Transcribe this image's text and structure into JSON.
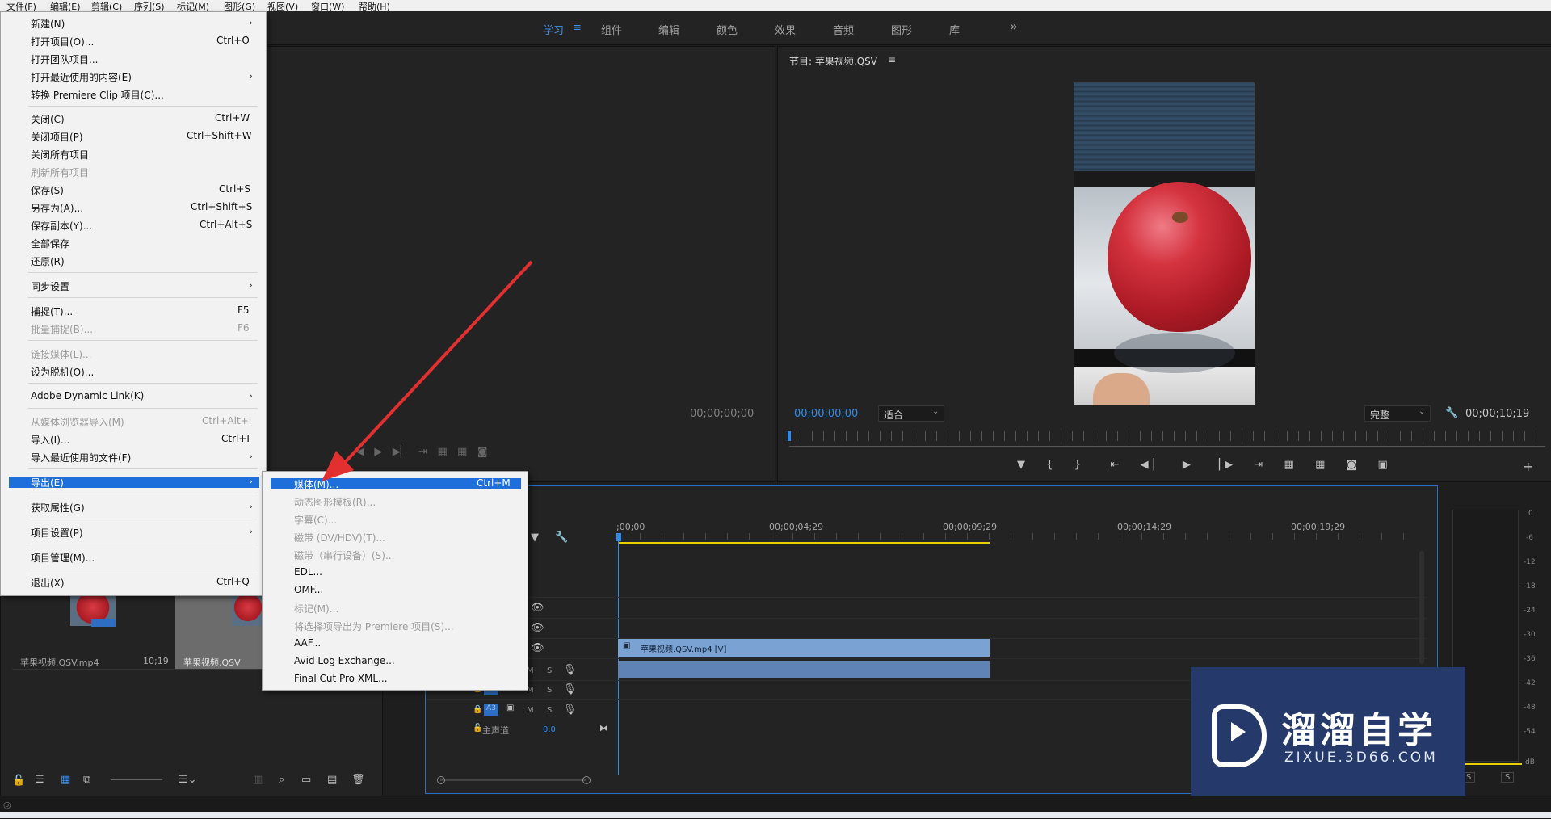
{
  "menubar": [
    "文件(F)",
    "编辑(E)",
    "剪辑(C)",
    "序列(S)",
    "标记(M)",
    "图形(G)",
    "视图(V)",
    "窗口(W)",
    "帮助(H)"
  ],
  "workspaces": [
    "学习",
    "组件",
    "编辑",
    "颜色",
    "效果",
    "音频",
    "图形",
    "库"
  ],
  "workspace_menu_icon": "≡",
  "more_icon": "»",
  "source_monitor": {
    "timecode": "00;00;00;00"
  },
  "program_monitor": {
    "title": "节目: 苹果视频.QSV",
    "title_menu": "≡",
    "timecode_left": "00;00;00;00",
    "fit_label": "适合",
    "quality_label": "完整",
    "timecode_right": "00;00;10;19"
  },
  "file_menu": {
    "items": [
      {
        "label": "新建(N)",
        "shortcut": "",
        "arrow": true,
        "disabled": false
      },
      {
        "label": "打开项目(O)...",
        "shortcut": "Ctrl+O",
        "arrow": false,
        "disabled": false
      },
      {
        "label": "打开团队项目...",
        "shortcut": "",
        "arrow": false,
        "disabled": false
      },
      {
        "label": "打开最近使用的内容(E)",
        "shortcut": "",
        "arrow": true,
        "disabled": false
      },
      {
        "label": "转换 Premiere Clip 项目(C)...",
        "shortcut": "",
        "arrow": false,
        "disabled": false
      },
      {
        "label": "关闭(C)",
        "shortcut": "Ctrl+W",
        "arrow": false,
        "disabled": false
      },
      {
        "label": "关闭项目(P)",
        "shortcut": "Ctrl+Shift+W",
        "arrow": false,
        "disabled": false
      },
      {
        "label": "关闭所有项目",
        "shortcut": "",
        "arrow": false,
        "disabled": false
      },
      {
        "label": "刷新所有项目",
        "shortcut": "",
        "arrow": false,
        "disabled": true
      },
      {
        "label": "保存(S)",
        "shortcut": "Ctrl+S",
        "arrow": false,
        "disabled": false
      },
      {
        "label": "另存为(A)...",
        "shortcut": "Ctrl+Shift+S",
        "arrow": false,
        "disabled": false
      },
      {
        "label": "保存副本(Y)...",
        "shortcut": "Ctrl+Alt+S",
        "arrow": false,
        "disabled": false
      },
      {
        "label": "全部保存",
        "shortcut": "",
        "arrow": false,
        "disabled": false
      },
      {
        "label": "还原(R)",
        "shortcut": "",
        "arrow": false,
        "disabled": false
      },
      {
        "label": "同步设置",
        "shortcut": "",
        "arrow": true,
        "disabled": false
      },
      {
        "label": "捕捉(T)...",
        "shortcut": "F5",
        "arrow": false,
        "disabled": false
      },
      {
        "label": "批量捕捉(B)...",
        "shortcut": "F6",
        "arrow": false,
        "disabled": true
      },
      {
        "label": "链接媒体(L)...",
        "shortcut": "",
        "arrow": false,
        "disabled": true
      },
      {
        "label": "设为脱机(O)...",
        "shortcut": "",
        "arrow": false,
        "disabled": false
      },
      {
        "label": "Adobe Dynamic Link(K)",
        "shortcut": "",
        "arrow": true,
        "disabled": false
      },
      {
        "label": "从媒体浏览器导入(M)",
        "shortcut": "Ctrl+Alt+I",
        "arrow": false,
        "disabled": true
      },
      {
        "label": "导入(I)...",
        "shortcut": "Ctrl+I",
        "arrow": false,
        "disabled": false
      },
      {
        "label": "导入最近使用的文件(F)",
        "shortcut": "",
        "arrow": true,
        "disabled": false
      },
      {
        "label": "导出(E)",
        "shortcut": "",
        "arrow": true,
        "disabled": false
      },
      {
        "label": "获取属性(G)",
        "shortcut": "",
        "arrow": true,
        "disabled": false
      },
      {
        "label": "项目设置(P)",
        "shortcut": "",
        "arrow": true,
        "disabled": false
      },
      {
        "label": "项目管理(M)...",
        "shortcut": "",
        "arrow": false,
        "disabled": false
      },
      {
        "label": "退出(X)",
        "shortcut": "Ctrl+Q",
        "arrow": false,
        "disabled": false
      }
    ]
  },
  "export_submenu": {
    "items": [
      {
        "label": "媒体(M)...",
        "shortcut": "Ctrl+M",
        "disabled": false
      },
      {
        "label": "动态图形模板(R)...",
        "shortcut": "",
        "disabled": true
      },
      {
        "label": "字幕(C)...",
        "shortcut": "",
        "disabled": true
      },
      {
        "label": "磁带 (DV/HDV)(T)...",
        "shortcut": "",
        "disabled": true
      },
      {
        "label": "磁带（串行设备）(S)...",
        "shortcut": "",
        "disabled": true
      },
      {
        "label": "EDL...",
        "shortcut": "",
        "disabled": false
      },
      {
        "label": "OMF...",
        "shortcut": "",
        "disabled": false
      },
      {
        "label": "标记(M)...",
        "shortcut": "",
        "disabled": true
      },
      {
        "label": "将选择项导出为 Premiere 项目(S)...",
        "shortcut": "",
        "disabled": true
      },
      {
        "label": "AAF...",
        "shortcut": "",
        "disabled": false
      },
      {
        "label": "Avid Log Exchange...",
        "shortcut": "",
        "disabled": false
      },
      {
        "label": "Final Cut Pro XML...",
        "shortcut": "",
        "disabled": false
      }
    ]
  },
  "project": {
    "clips": [
      {
        "name": "苹果视频.QSV.mp4",
        "duration": "10;19"
      },
      {
        "name": "苹果视频.QSV",
        "duration": ""
      }
    ]
  },
  "timeline": {
    "timecodes": [
      ";00;00",
      "00;00;04;29",
      "00;00;09;29",
      "00;00;14;29",
      "00;00;19;29"
    ],
    "video_clip_label": "苹果视频.QSV.mp4 [V]",
    "tracks": [
      {
        "name": "A2",
        "m": "M",
        "s": "S"
      },
      {
        "name": "A3",
        "m": "M",
        "s": "S"
      }
    ],
    "master_label": "主声道",
    "master_value": "0.0",
    "track_letters": {
      "m": "M",
      "s": "S"
    }
  },
  "meter_labels": [
    "0",
    "-6",
    "-12",
    "-18",
    "-24",
    "-30",
    "-36",
    "-42",
    "-48",
    "-54",
    "dB"
  ],
  "meter_buttons": [
    "S",
    "S"
  ],
  "watermark": {
    "title": "溜溜自学",
    "url": "ZIXUE.3D66.COM"
  },
  "colors": {
    "accent": "#1e6fdc",
    "timecode_blue": "#2d8ceb",
    "clip_blue": "#7aa3d4",
    "marker_yellow": "#e8d100"
  }
}
